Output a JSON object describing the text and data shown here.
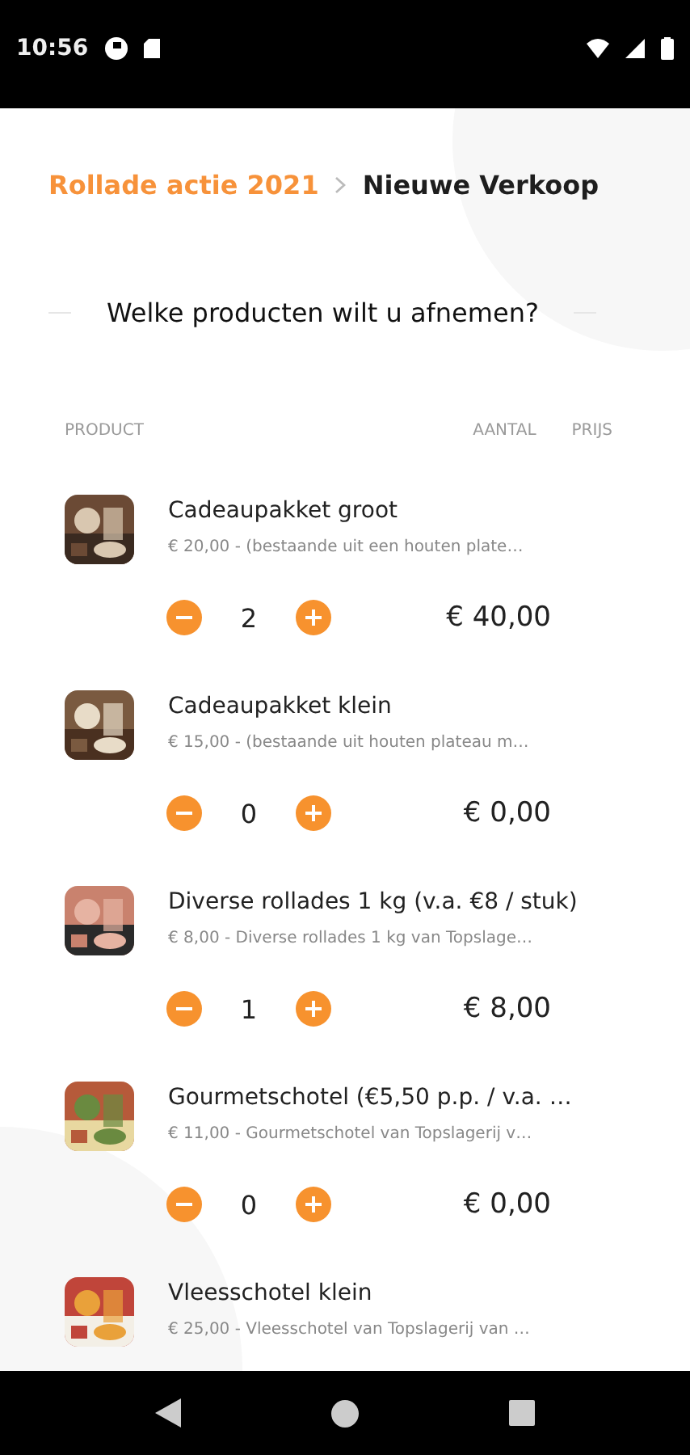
{
  "status_bar": {
    "time": "10:56"
  },
  "breadcrumb": {
    "parent": "Rollade actie 2021",
    "current": "Nieuwe Verkoop"
  },
  "question": "Welke producten wilt u afnemen?",
  "table": {
    "columns": [
      "PRODUCT",
      "AANTAL",
      "PRIJS"
    ],
    "rows": [
      {
        "name": "Cadeaupakket groot",
        "description": "€ 20,00 - (bestaande uit een houten plate…",
        "quantity": "2",
        "total": "€ 40,00"
      },
      {
        "name": "Cadeaupakket klein",
        "description": "€ 15,00 - (bestaande uit houten plateau m…",
        "quantity": "0",
        "total": "€ 0,00"
      },
      {
        "name": "Diverse rollades 1 kg (v.a. €8 / stuk)",
        "description": "€ 8,00 - Diverse rollades 1 kg van Topslage…",
        "quantity": "1",
        "total": "€ 8,00"
      },
      {
        "name": "Gourmetschotel (€5,50 p.p. / v.a. …",
        "description": "€ 11,00 - Gourmetschotel van Topslagerij v…",
        "quantity": "0",
        "total": "€ 0,00"
      },
      {
        "name": "Vleesschotel klein",
        "description": "€ 25,00 - Vleesschotel van Topslagerij van …"
      }
    ]
  }
}
